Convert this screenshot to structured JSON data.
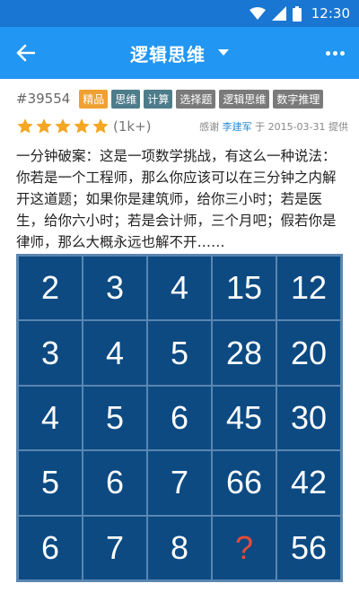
{
  "status_bar": {
    "time": "12:30"
  },
  "app_bar": {
    "title": "逻辑思维"
  },
  "question": {
    "id": "#39554",
    "tags": [
      {
        "label": "精品",
        "color": "#f0a030"
      },
      {
        "label": "思维",
        "color": "#4d7c8a"
      },
      {
        "label": "计算",
        "color": "#4d7c8a"
      },
      {
        "label": "选择题",
        "color": "#7a7a7a"
      },
      {
        "label": "逻辑思维",
        "color": "#7a7a7a"
      },
      {
        "label": "数字推理",
        "color": "#7a7a7a"
      }
    ],
    "rating": {
      "stars": 5,
      "count": "(1k+)"
    },
    "credit": {
      "thanks": "感谢",
      "author": "李建军",
      "middle": "于 2015-03-31 提供"
    },
    "description": "一分钟破案：这是一项数学挑战，有这么一种说法：你若是一个工程师，那么你应该可以在三分钟之内解开这道题；如果你是建筑师，给你三小时；若是医生，给你六小时；若是会计师，三个月吧；假若你是律师，那么大概永远也解不开……",
    "grid": [
      [
        "2",
        "3",
        "4",
        "15",
        "12"
      ],
      [
        "3",
        "4",
        "5",
        "28",
        "20"
      ],
      [
        "4",
        "5",
        "6",
        "45",
        "30"
      ],
      [
        "5",
        "6",
        "7",
        "66",
        "42"
      ],
      [
        "6",
        "7",
        "8",
        "?",
        "56"
      ]
    ]
  }
}
